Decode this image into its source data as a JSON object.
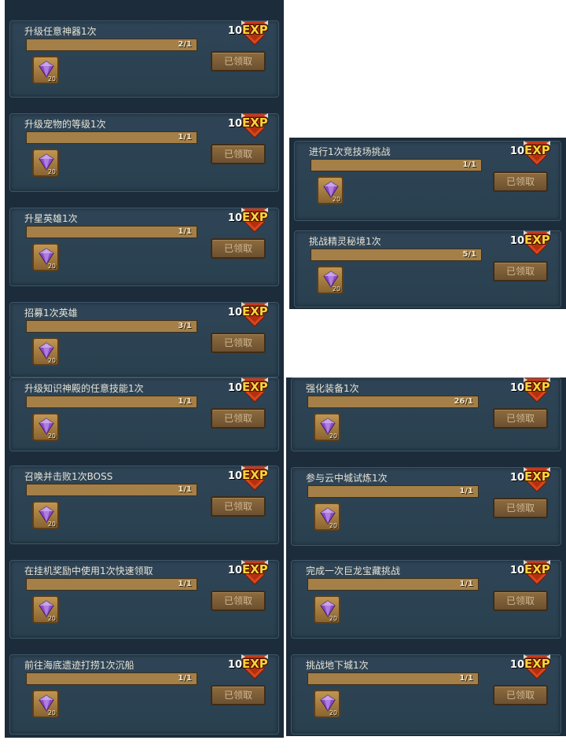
{
  "common": {
    "exp_label": "EXP",
    "claimed_label": "已领取",
    "reward_icon": "purple-gem-icon"
  },
  "colors": {
    "panel_bg": "#1c2c3a",
    "card_bg": "#2f4557",
    "progress": "#8d6a37",
    "exp_yellow": "#f7d43a",
    "ribbon_red": "#c43b1e",
    "gem_purple": "#8a4cc4"
  },
  "panels": [
    {
      "tasks": [
        {
          "title": "升级任意神器1次",
          "progress_text": "2/1",
          "progress": 1.0,
          "exp": "10",
          "reward_count": "20"
        },
        {
          "title": "升级宠物的等级1次",
          "progress_text": "1/1",
          "progress": 1.0,
          "exp": "10",
          "reward_count": "20"
        },
        {
          "title": "升星英雄1次",
          "progress_text": "1/1",
          "progress": 1.0,
          "exp": "10",
          "reward_count": "20"
        },
        {
          "title": "招募1次英雄",
          "progress_text": "3/1",
          "progress": 1.0,
          "exp": "10",
          "reward_count": "20"
        }
      ]
    },
    {
      "tasks": [
        {
          "title": "进行1次竞技场挑战",
          "progress_text": "1/1",
          "progress": 1.0,
          "exp": "10",
          "reward_count": "20"
        },
        {
          "title": "挑战精灵秘境1次",
          "progress_text": "5/1",
          "progress": 1.0,
          "exp": "10",
          "reward_count": "20"
        }
      ]
    },
    {
      "tasks": [
        {
          "title": "升级知识神殿的任意技能1次",
          "progress_text": "1/1",
          "progress": 1.0,
          "exp": "10",
          "reward_count": "20"
        },
        {
          "title": "召唤并击败1次BOSS",
          "progress_text": "1/1",
          "progress": 1.0,
          "exp": "10",
          "reward_count": "20"
        },
        {
          "title": "在挂机奖励中使用1次快速领取",
          "progress_text": "1/1",
          "progress": 1.0,
          "exp": "10",
          "reward_count": "20"
        },
        {
          "title": "前往海底遗迹打捞1次沉船",
          "progress_text": "1/1",
          "progress": 1.0,
          "exp": "10",
          "reward_count": "20"
        }
      ]
    },
    {
      "tasks": [
        {
          "title": "强化装备1次",
          "progress_text": "26/1",
          "progress": 1.0,
          "exp": "10",
          "reward_count": "20"
        },
        {
          "title": "参与云中城试炼1次",
          "progress_text": "1/1",
          "progress": 1.0,
          "exp": "10",
          "reward_count": "20"
        },
        {
          "title": "完成一次巨龙宝藏挑战",
          "progress_text": "1/1",
          "progress": 1.0,
          "exp": "10",
          "reward_count": "20"
        },
        {
          "title": "挑战地下城1次",
          "progress_text": "1/1",
          "progress": 1.0,
          "exp": "10",
          "reward_count": "20"
        }
      ]
    }
  ]
}
